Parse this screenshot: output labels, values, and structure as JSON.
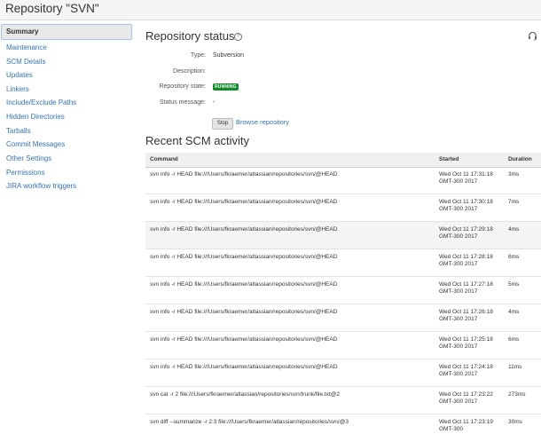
{
  "header": {
    "title": "Repository \"SVN\""
  },
  "sidebar": {
    "items": [
      {
        "label": "Summary"
      },
      {
        "label": "Maintenance"
      },
      {
        "label": "SCM Details"
      },
      {
        "label": "Updates"
      },
      {
        "label": "Linkers"
      },
      {
        "label": "Include/Exclude Paths"
      },
      {
        "label": "Hidden Directories"
      },
      {
        "label": "Tarballs"
      },
      {
        "label": "Commit Messages"
      },
      {
        "label": "Other Settings"
      },
      {
        "label": "Permissions"
      },
      {
        "label": "JIRA workflow triggers"
      }
    ]
  },
  "status": {
    "title": "Repository status",
    "type_label": "Type:",
    "type_value": "Subversion",
    "description_label": "Description:",
    "description_value": "",
    "state_label": "Repository state:",
    "state_value": "RUNNING",
    "message_label": "Status message:",
    "message_value": "-",
    "stop_label": "Stop",
    "browse_label": "Browse repository"
  },
  "activity": {
    "title": "Recent SCM activity",
    "columns": {
      "command": "Command",
      "started": "Started",
      "duration": "Duration"
    },
    "rows": [
      {
        "command": "svn info -r HEAD file:///Users/fkraemer/atlassian/repositories/svn/@HEAD",
        "started": "Wed Oct 11 17:31:18 GMT-300 2017",
        "duration": "3ms"
      },
      {
        "command": "svn info -r HEAD file:///Users/fkraemer/atlassian/repositories/svn/@HEAD",
        "started": "Wed Oct 11 17:30:18 GMT-300 2017",
        "duration": "7ms"
      },
      {
        "command": "svn info -r HEAD file:///Users/fkraemer/atlassian/repositories/svn/@HEAD",
        "started": "Wed Oct 11 17:29:18 GMT-300 2017",
        "duration": "4ms"
      },
      {
        "command": "svn info -r HEAD file:///Users/fkraemer/atlassian/repositories/svn/@HEAD",
        "started": "Wed Oct 11 17:28:18 GMT-300 2017",
        "duration": "6ms"
      },
      {
        "command": "svn info -r HEAD file:///Users/fkraemer/atlassian/repositories/svn/@HEAD",
        "started": "Wed Oct 11 17:27:18 GMT-300 2017",
        "duration": "5ms"
      },
      {
        "command": "svn info -r HEAD file:///Users/fkraemer/atlassian/repositories/svn/@HEAD",
        "started": "Wed Oct 11 17:26:18 GMT-300 2017",
        "duration": "4ms"
      },
      {
        "command": "svn info -r HEAD file:///Users/fkraemer/atlassian/repositories/svn/@HEAD",
        "started": "Wed Oct 11 17:25:18 GMT-300 2017",
        "duration": "6ms"
      },
      {
        "command": "svn info -r HEAD file:///Users/fkraemer/atlassian/repositories/svn/@HEAD",
        "started": "Wed Oct 11 17:24:18 GMT-300 2017",
        "duration": "11ms"
      },
      {
        "command": "svn cat -r 2 file:///Users/fkraemer/atlassian/repositories/svn/trunk/file.txt@2",
        "started": "Wed Oct 11 17:23:22 GMT-300 2017",
        "duration": "273ms"
      },
      {
        "command": "svn diff --summarize -r 2:3 file:///Users/fkraemer/atlassian/repositories/svn/@3",
        "started": "Wed Oct 11 17:23:19 GMT-300",
        "duration": "30ms"
      }
    ]
  },
  "icons": {
    "help": "help-icon",
    "headset": "headset-icon"
  },
  "colors": {
    "link": "#3572b0",
    "running_badge": "#14892c",
    "active_border": "#a5c3ee"
  }
}
